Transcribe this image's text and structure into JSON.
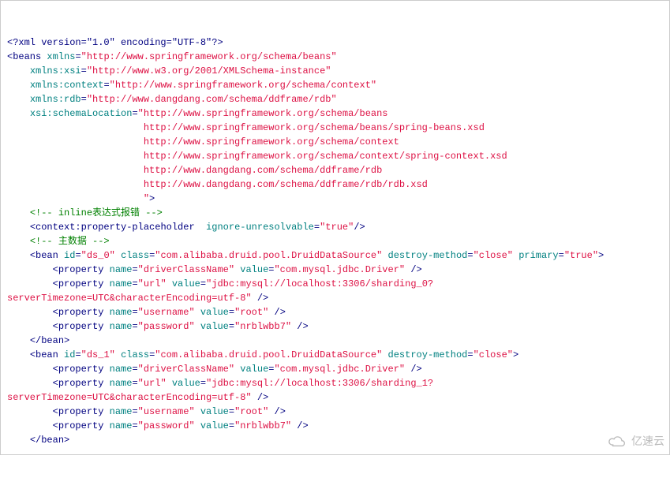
{
  "prolog": {
    "raw": "<?xml version=\"1.0\" encoding=\"UTF-8\"?>",
    "version": "1.0",
    "encoding": "UTF-8"
  },
  "root": {
    "tag": "beans",
    "xmlns": "http://www.springframework.org/schema/beans",
    "xmlns_xsi": "http://www.w3.org/2001/XMLSchema-instance",
    "xmlns_context": "http://www.springframework.org/schema/context",
    "xmlns_rdb": "http://www.dangdang.com/schema/ddframe/rdb",
    "schema_loc": [
      "http://www.springframework.org/schema/beans",
      "http://www.springframework.org/schema/beans/spring-beans.xsd",
      "http://www.springframework.org/schema/context",
      "http://www.springframework.org/schema/context/spring-context.xsd",
      "http://www.dangdang.com/schema/ddframe/rdb",
      "http://www.dangdang.com/schema/ddframe/rdb/rdb.xsd"
    ]
  },
  "comment1": "<!-- inline表达式报错 -->",
  "placeholder": {
    "tag": "context:property-placeholder",
    "attr": "ignore-unresolvable",
    "val": "true"
  },
  "comment2": "<!-- 主数据 -->",
  "beans": [
    {
      "id": "ds_0",
      "class": "com.alibaba.druid.pool.DruidDataSource",
      "destroy": "close",
      "primary": "true",
      "props": [
        {
          "name": "driverClassName",
          "value": "com.mysql.jdbc.Driver"
        },
        {
          "name": "url",
          "value": "jdbc:mysql://localhost:3306/sharding_0?serverTimezone=UTC&amp;characterEncoding=utf-8"
        },
        {
          "name": "username",
          "value": "root"
        },
        {
          "name": "password",
          "value": "nrblwbb7"
        }
      ]
    },
    {
      "id": "ds_1",
      "class": "com.alibaba.druid.pool.DruidDataSource",
      "destroy": "close",
      "props": [
        {
          "name": "driverClassName",
          "value": "com.mysql.jdbc.Driver"
        },
        {
          "name": "url",
          "value": "jdbc:mysql://localhost:3306/sharding_1?serverTimezone=UTC&amp;characterEncoding=utf-8"
        },
        {
          "name": "username",
          "value": "root"
        },
        {
          "name": "password",
          "value": "nrblwbb7"
        }
      ]
    }
  ],
  "attrNames": {
    "xmlns": "xmlns",
    "xsi": "xmlns:xsi",
    "context": "xmlns:context",
    "rdb": "xmlns:rdb",
    "schemaLocation": "xsi:schemaLocation",
    "id": "id",
    "class": "class",
    "destroy": "destroy-method",
    "primary": "primary",
    "name": "name",
    "value": "value"
  },
  "tags": {
    "bean": "bean",
    "property": "property"
  },
  "indent": {
    "i1": "    ",
    "i2": "        ",
    "schema": "                        "
  },
  "watermark": "亿速云"
}
